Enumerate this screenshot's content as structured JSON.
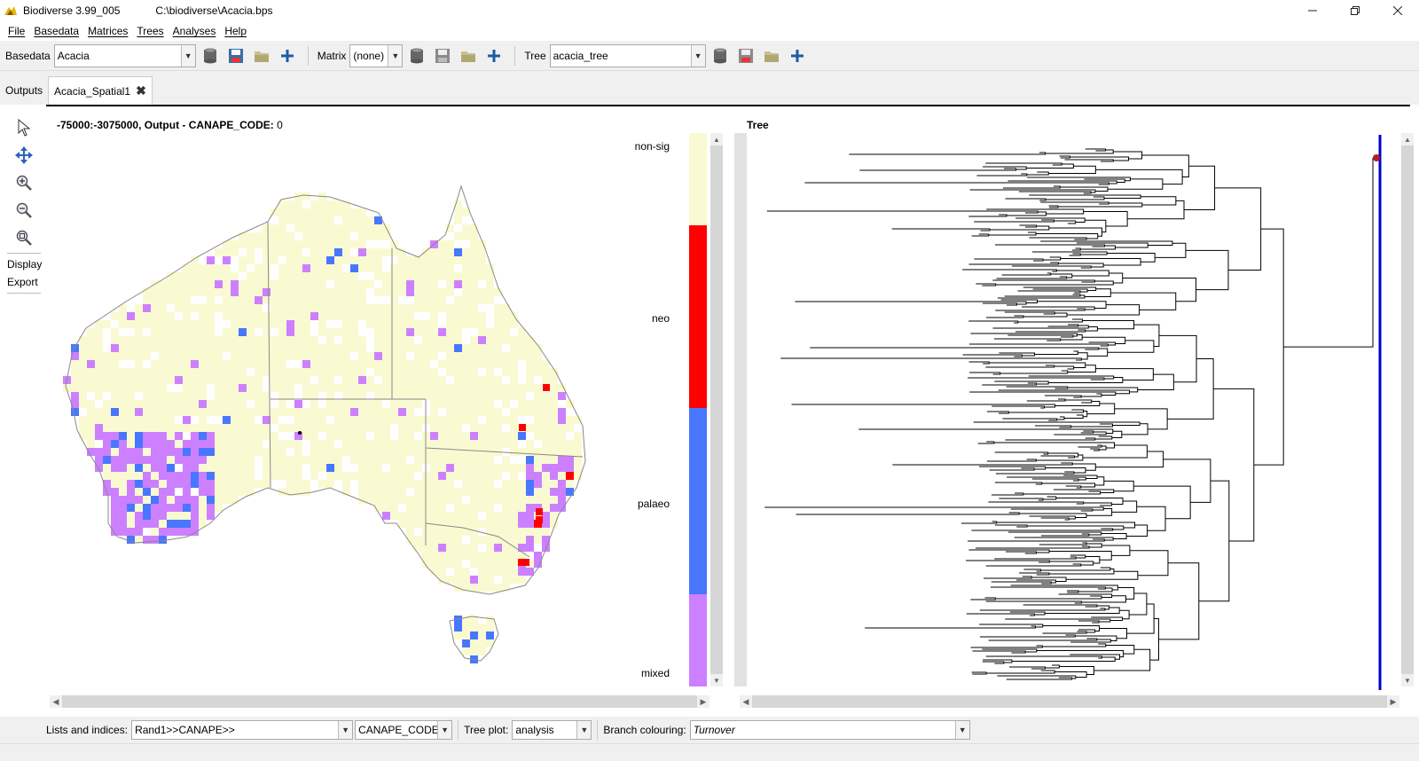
{
  "titlebar": {
    "app_title": "Biodiverse 3.99_005",
    "file_path": "C:\\biodiverse\\Acacia.bps"
  },
  "menu": [
    "File",
    "Basedata",
    "Matrices",
    "Trees",
    "Analyses",
    "Help"
  ],
  "toolbar": {
    "basedata_label": "Basedata",
    "basedata_value": "Acacia",
    "matrix_label": "Matrix",
    "matrix_value": "(none)",
    "tree_label": "Tree",
    "tree_value": "acacia_tree"
  },
  "tabs": {
    "outputs": "Outputs",
    "spatial": "Acacia_Spatial1"
  },
  "side_tools": {
    "display": "Display",
    "export": "Export"
  },
  "map": {
    "coord_text": "-75000:-3075000, Output - ",
    "index_name": "CANAPE_CODE:",
    "index_value": "0"
  },
  "legend": {
    "labels": [
      "non-sig",
      "neo",
      "palaeo",
      "mixed"
    ],
    "colors": {
      "non_sig": "#fafad2",
      "neo": "#ff0000",
      "palaeo": "#4876ff",
      "mixed": "#cc80ff"
    }
  },
  "tree": {
    "title": "Tree"
  },
  "bottom": {
    "lists_label": "Lists and indices:",
    "lists_value": "Rand1>>CANAPE>>",
    "index_value": "CANAPE_CODE",
    "tree_plot_label": "Tree plot:",
    "tree_plot_value": "analysis",
    "branch_label": "Branch colouring:",
    "branch_value": "Turnover"
  }
}
